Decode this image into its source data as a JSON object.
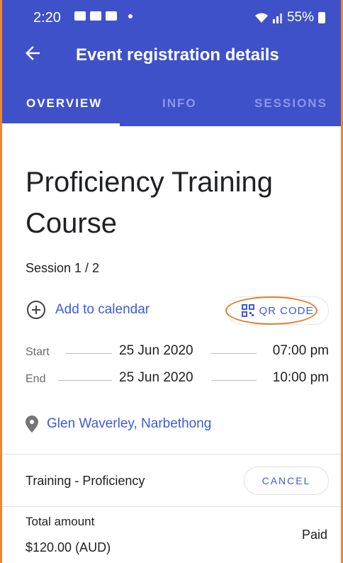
{
  "status_bar": {
    "time": "2:20",
    "battery": "55%"
  },
  "toolbar": {
    "title": "Event registration details"
  },
  "tabs": [
    {
      "label": "OVERVIEW",
      "active": true
    },
    {
      "label": "INFO",
      "active": false
    },
    {
      "label": "SESSIONS",
      "active": false
    }
  ],
  "event": {
    "title": "Proficiency Training Course",
    "session": "Session 1 / 2",
    "add_to_calendar": "Add to calendar",
    "qr_code": "QR CODE",
    "start": {
      "label": "Start",
      "date": "25 Jun 2020",
      "time": "07:00 pm"
    },
    "end": {
      "label": "End",
      "date": "25 Jun 2020",
      "time": "10:00 pm"
    },
    "location": "Glen Waverley, Narbethong"
  },
  "ticket": {
    "name": "Training - Proficiency",
    "cancel_label": "CANCEL"
  },
  "payment": {
    "total_label": "Total amount",
    "amount": "$120.00 (AUD)",
    "status": "Paid"
  },
  "colors": {
    "app_bar": "#3f51c9",
    "accent": "#3d5bd9",
    "highlight": "#e37d2c"
  }
}
